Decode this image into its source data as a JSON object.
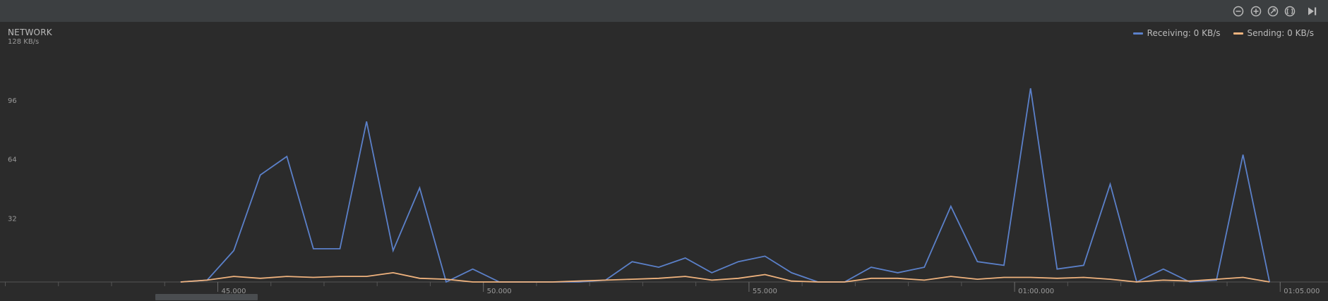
{
  "toolbar": {
    "buttons": [
      {
        "name": "zoom-out-button",
        "icon": "minus-circle-icon"
      },
      {
        "name": "zoom-in-button",
        "icon": "plus-circle-icon"
      },
      {
        "name": "reset-zoom-button",
        "icon": "reset-circle-icon"
      },
      {
        "name": "fit-button",
        "icon": "fit-circle-icon"
      },
      {
        "name": "go-live-button",
        "icon": "skip-to-end-icon"
      }
    ]
  },
  "panel": {
    "title": "NETWORK"
  },
  "legend": {
    "receiving": "Receiving: 0 KB/s",
    "sending": "Sending: 0 KB/s"
  },
  "colors": {
    "receiving": "#5b80c9",
    "sending": "#f0b37e",
    "background": "#2b2b2b",
    "toolbar": "#3c3f41",
    "axis": "#555555"
  },
  "chart_data": {
    "type": "line",
    "title": "NETWORK",
    "ylabel": "",
    "xlabel": "",
    "ylim": [
      0,
      128
    ],
    "y_ticks": [
      {
        "value": 32,
        "label": "32"
      },
      {
        "value": 64,
        "label": "64"
      },
      {
        "value": 96,
        "label": "96"
      },
      {
        "value": 128,
        "label": "128 KB/s"
      }
    ],
    "xlim": [
      40.9,
      65.9
    ],
    "x_ticks": [
      {
        "value": 45,
        "label": "45.000"
      },
      {
        "value": 50,
        "label": "50.000"
      },
      {
        "value": 55,
        "label": "55.000"
      },
      {
        "value": 60,
        "label": "01:00.000"
      },
      {
        "value": 65,
        "label": "01:05.000"
      }
    ],
    "x_minor_step": 1,
    "grid": false,
    "legend_position": "top-right",
    "series": [
      {
        "name": "Receiving",
        "color": "#5b80c9",
        "x": [
          44.3,
          44.8,
          45.3,
          45.8,
          46.3,
          46.8,
          47.3,
          47.8,
          48.3,
          48.8,
          49.3,
          49.8,
          50.3,
          50.8,
          51.3,
          51.8,
          52.3,
          52.8,
          53.3,
          53.8,
          54.3,
          54.8,
          55.3,
          55.8,
          56.3,
          56.8,
          57.3,
          57.8,
          58.3,
          58.8,
          59.3,
          59.8,
          60.3,
          60.8,
          61.3,
          61.8,
          62.3,
          62.8,
          63.3,
          63.8,
          64.3,
          64.8
        ],
        "y": [
          0,
          1,
          17,
          58,
          68,
          18,
          18,
          87,
          17,
          51,
          0,
          7,
          0,
          0,
          0,
          0,
          1,
          11,
          8,
          13,
          5,
          11,
          14,
          5,
          0,
          0,
          8,
          5,
          8,
          41,
          11,
          9,
          105,
          7,
          9,
          53,
          0,
          7,
          0,
          1,
          69,
          0
        ]
      },
      {
        "name": "Sending",
        "color": "#f0b37e",
        "x": [
          44.3,
          44.8,
          45.3,
          45.8,
          46.3,
          46.8,
          47.3,
          47.8,
          48.3,
          48.8,
          49.3,
          49.8,
          50.3,
          50.8,
          51.3,
          51.8,
          52.3,
          52.8,
          53.3,
          53.8,
          54.3,
          54.8,
          55.3,
          55.8,
          56.3,
          56.8,
          57.3,
          57.8,
          58.3,
          58.8,
          59.3,
          59.8,
          60.3,
          60.8,
          61.3,
          61.8,
          62.3,
          62.8,
          63.3,
          63.8,
          64.3,
          64.8
        ],
        "y": [
          0,
          1,
          3,
          2,
          3,
          2.5,
          3,
          3,
          5,
          2,
          1.5,
          0,
          0,
          0,
          0,
          0.5,
          1,
          1.5,
          2,
          3,
          1,
          2,
          4,
          0.5,
          0,
          0,
          2,
          2,
          1,
          3,
          1.5,
          2.5,
          2.5,
          2,
          2.5,
          1.5,
          0,
          1,
          0.5,
          1.5,
          2.5,
          0
        ]
      }
    ]
  },
  "scrollbar": {
    "thumb_start": 0.117,
    "thumb_end": 0.194
  }
}
